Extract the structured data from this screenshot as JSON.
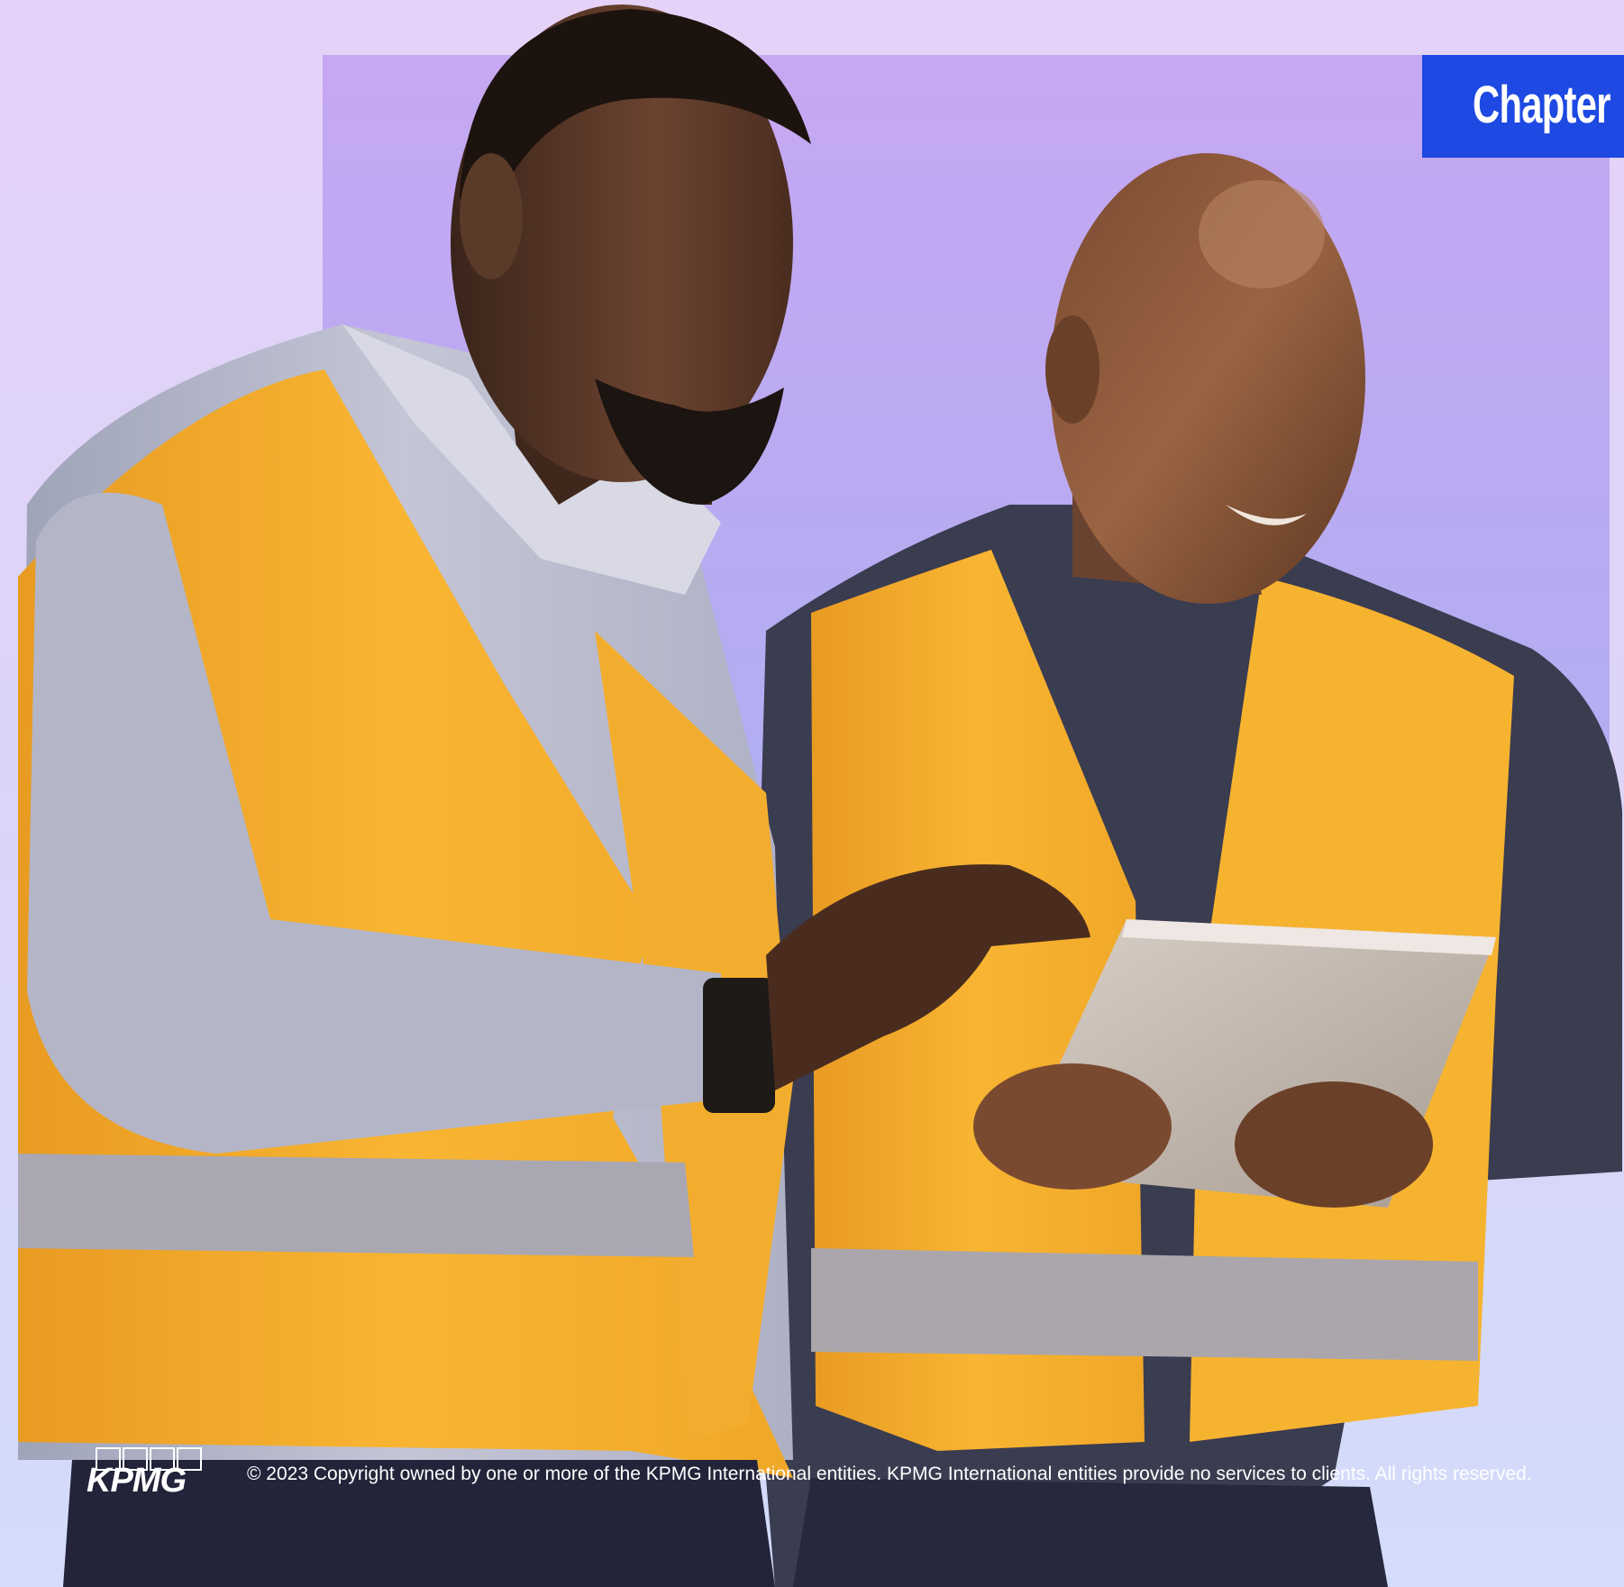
{
  "chapter_tab": {
    "label": "Chapter"
  },
  "photo": {
    "subject": "two-workers-with-tablet"
  },
  "footer": {
    "logo_text": "KPMG",
    "copyright": "© 2023 Copyright owned by one or more of the KPMG International entities. KPMG International entities provide no services to clients. All rights reserved."
  },
  "colors": {
    "background_top": "#e6d2f8",
    "background_bottom": "#d3dcfa",
    "panel": "#bba9f2",
    "chapter_tab": "#1e49e2",
    "vest": "#f6b330",
    "text": "#ffffff"
  }
}
